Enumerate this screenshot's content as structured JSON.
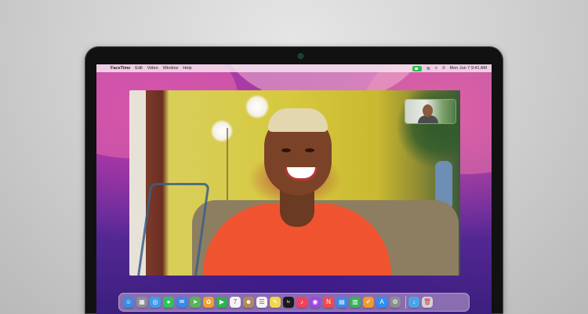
{
  "menubar": {
    "apple_glyph": "",
    "app_name": "FaceTime",
    "menus": [
      "Edit",
      "Video",
      "Window",
      "Help"
    ],
    "status_clock": "Mon Jun 7  9:41 AM",
    "wifi_glyph": "≋",
    "search_glyph": "⌕",
    "control_glyph": "≡"
  },
  "dock": {
    "apps": [
      {
        "name": "finder",
        "color": "#3d8ae0",
        "glyph": "☺"
      },
      {
        "name": "launchpad",
        "color": "#8d8d98",
        "glyph": "▦"
      },
      {
        "name": "safari",
        "color": "#3b9ef0",
        "glyph": "◎"
      },
      {
        "name": "messages",
        "color": "#2ec45a",
        "glyph": "●"
      },
      {
        "name": "mail",
        "color": "#3a87e8",
        "glyph": "✉"
      },
      {
        "name": "maps",
        "color": "#58b458",
        "glyph": "➤"
      },
      {
        "name": "photos",
        "color": "#f0a030",
        "glyph": "✿"
      },
      {
        "name": "facetime",
        "color": "#2bb34e",
        "glyph": "▶"
      },
      {
        "name": "calendar",
        "color": "#f4f4f4",
        "glyph": "7"
      },
      {
        "name": "contacts",
        "color": "#b08a5a",
        "glyph": "☻"
      },
      {
        "name": "reminders",
        "color": "#f4f4f4",
        "glyph": "☰"
      },
      {
        "name": "notes",
        "color": "#f2d64a",
        "glyph": "✎"
      },
      {
        "name": "tv",
        "color": "#1a1a1a",
        "glyph": "tv"
      },
      {
        "name": "music",
        "color": "#f0435a",
        "glyph": "♪"
      },
      {
        "name": "podcasts",
        "color": "#9b4ae0",
        "glyph": "◉"
      },
      {
        "name": "news",
        "color": "#f34a4a",
        "glyph": "N"
      },
      {
        "name": "keynote",
        "color": "#3a8ae8",
        "glyph": "▤"
      },
      {
        "name": "numbers",
        "color": "#33b457",
        "glyph": "▥"
      },
      {
        "name": "pages",
        "color": "#f09a2a",
        "glyph": "✐"
      },
      {
        "name": "app-store",
        "color": "#2f8ff0",
        "glyph": "A"
      },
      {
        "name": "system-preferences",
        "color": "#8c8c92",
        "glyph": "⚙"
      },
      {
        "name": "downloads",
        "color": "#4ba4e8",
        "glyph": "↓"
      },
      {
        "name": "trash",
        "color": "#cfd4da",
        "glyph": "🗑"
      }
    ]
  }
}
